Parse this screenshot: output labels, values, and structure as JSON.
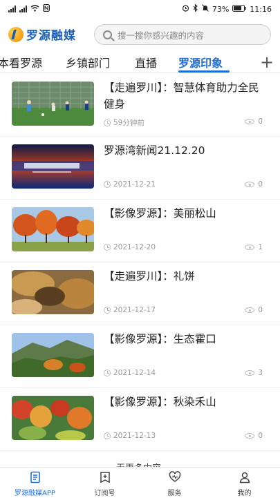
{
  "status_bar": {
    "left_icons": [
      "signal-icon",
      "signal-icon",
      "wifi-icon",
      "nfc-icon"
    ],
    "battery": "73%",
    "time": "11:16"
  },
  "header": {
    "logo_text": "罗源融媒",
    "search_placeholder": "搜一搜你感兴趣的内容"
  },
  "tabs": [
    {
      "label": "本看罗源",
      "active": false
    },
    {
      "label": "乡镇部门",
      "active": false
    },
    {
      "label": "直播",
      "active": false
    },
    {
      "label": "罗源印象",
      "active": true
    }
  ],
  "add_tab_label": "+",
  "articles": [
    {
      "title": "【走遍罗川】：智慧体育助力全民健身",
      "date": "59分钟前",
      "views": "0",
      "thumb": "soccer-field"
    },
    {
      "title": "罗源湾新闻21.12.20",
      "date": "2021-12-21",
      "views": "0",
      "thumb": "news-broadcast"
    },
    {
      "title": "【影像罗源】：美丽松山",
      "date": "2021-12-20",
      "views": "1",
      "thumb": "autumn-trees"
    },
    {
      "title": "【走遍罗川】：礼饼",
      "date": "2021-12-17",
      "views": "0",
      "thumb": "cake"
    },
    {
      "title": "【影像罗源】：生态霍口",
      "date": "2021-12-14",
      "views": "3",
      "thumb": "mountain-village"
    },
    {
      "title": "【影像罗源】：秋染禾山",
      "date": "2021-12-13",
      "views": "0",
      "thumb": "autumn-forest"
    }
  ],
  "more_text": "无更多内容",
  "bottom_nav": [
    {
      "label": "罗源融媒APP",
      "icon": "document-icon",
      "active": true
    },
    {
      "label": "订阅号",
      "icon": "subscribe-icon",
      "active": false
    },
    {
      "label": "服务",
      "icon": "service-icon",
      "active": false
    },
    {
      "label": "我的",
      "icon": "profile-icon",
      "active": false
    }
  ],
  "colors": {
    "accent": "#1e6fd8",
    "logo": "#1b5fb5"
  }
}
